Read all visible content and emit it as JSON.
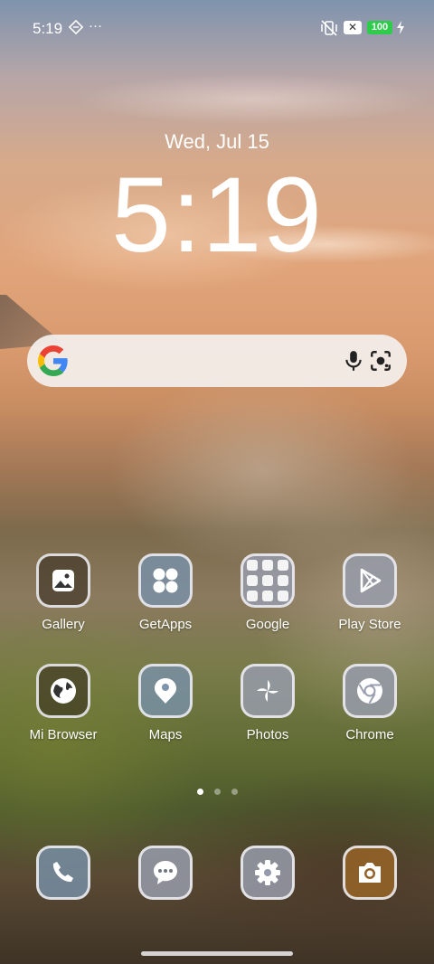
{
  "status_bar": {
    "time": "5:19",
    "more": "···",
    "battery": "100",
    "x_badge": "✕"
  },
  "lock": {
    "date": "Wed, Jul 15",
    "time": "5:19"
  },
  "apps_row1": [
    {
      "label": "Gallery",
      "icon": "gallery-icon"
    },
    {
      "label": "GetApps",
      "icon": "getapps-icon"
    },
    {
      "label": "Google",
      "icon": "google-folder-icon"
    },
    {
      "label": "Play Store",
      "icon": "play-store-icon"
    }
  ],
  "apps_row2": [
    {
      "label": "Mi Browser",
      "icon": "globe-icon"
    },
    {
      "label": "Maps",
      "icon": "maps-icon"
    },
    {
      "label": "Photos",
      "icon": "photos-icon"
    },
    {
      "label": "Chrome",
      "icon": "chrome-icon"
    }
  ],
  "dock": [
    {
      "icon": "phone-icon"
    },
    {
      "icon": "messages-icon"
    },
    {
      "icon": "settings-icon"
    },
    {
      "icon": "camera-icon"
    }
  ],
  "colors": {
    "battery": "#2ecc4a",
    "google_blue": "#4285F4",
    "google_red": "#EA4335",
    "google_yellow": "#FBBC05",
    "google_green": "#34A853"
  }
}
